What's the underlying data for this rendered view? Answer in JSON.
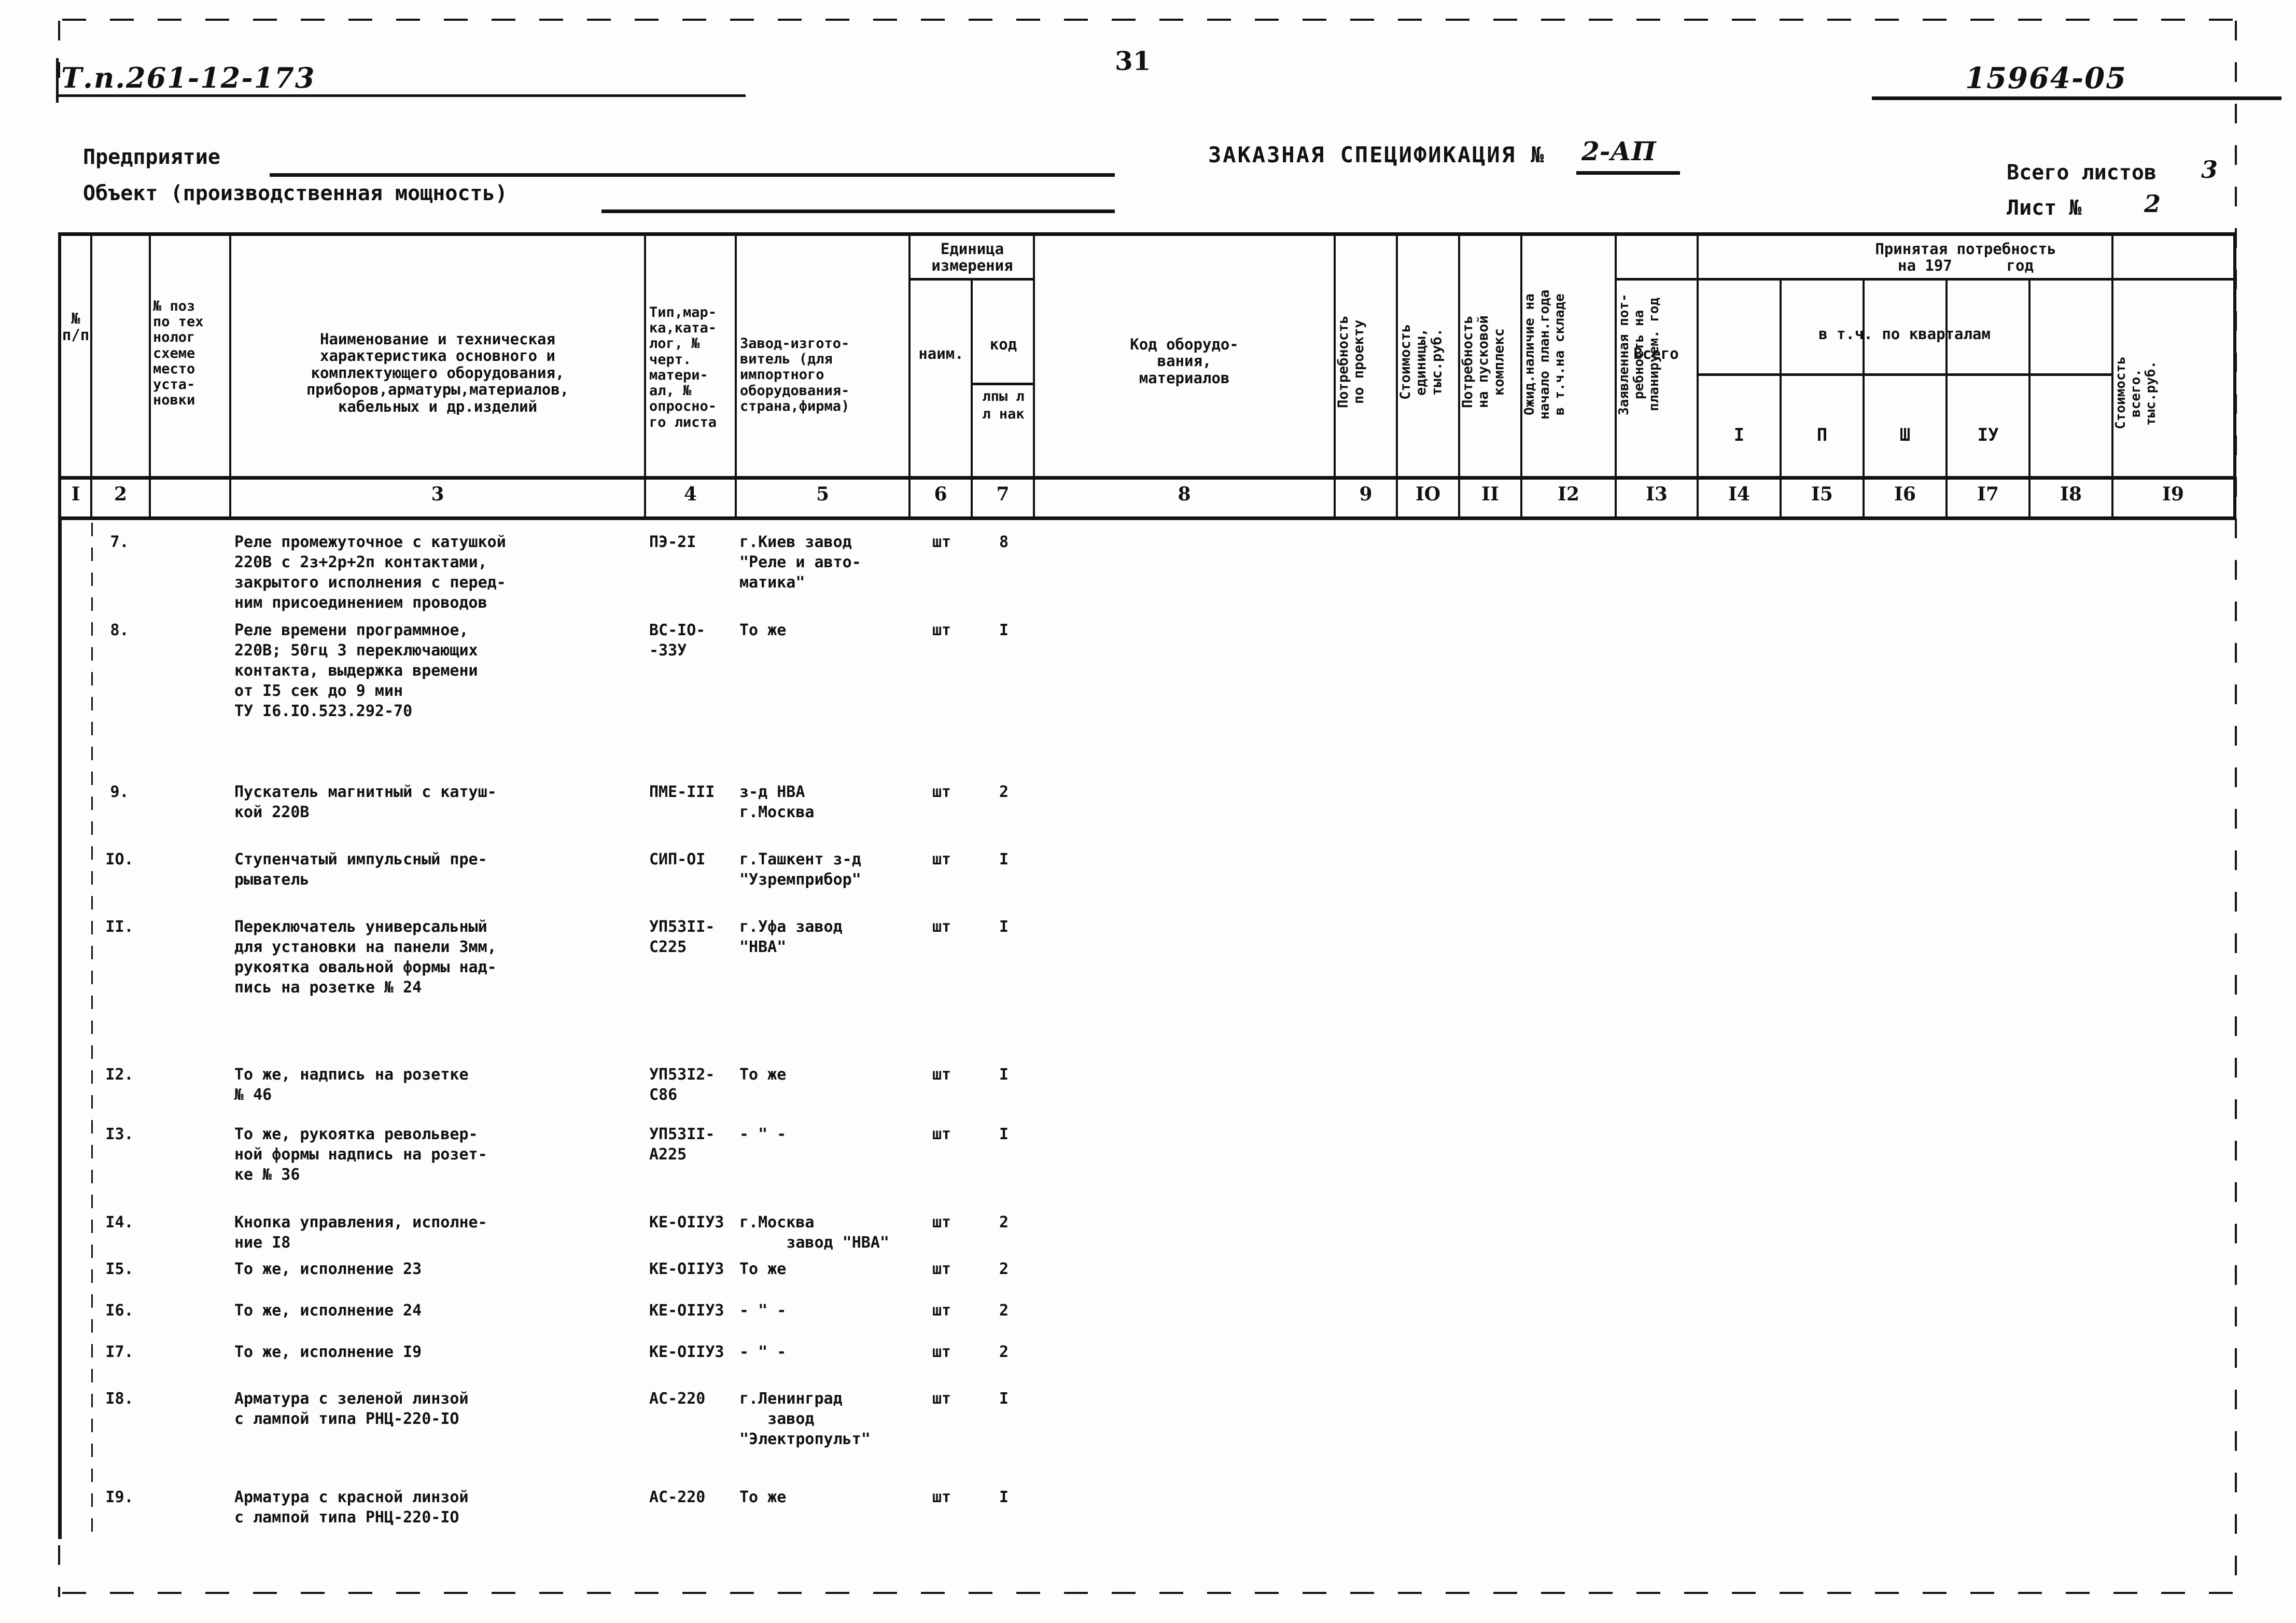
{
  "header": {
    "project_code": "Т.п.261-12-173",
    "page_number": "31",
    "document_number": "15964-05",
    "enterprise_label": "Предприятие",
    "object_label": "Объект (производственная мощность)",
    "spec_title": "ЗАКАЗНАЯ СПЕЦИФИКАЦИЯ №",
    "spec_number": "2-АП",
    "total_sheets_label": "Всего листов",
    "total_sheets_value": "3",
    "sheet_label": "Лист №",
    "sheet_value": "2"
  },
  "table": {
    "headers": {
      "c1": "№\nп/п",
      "c2": "№ поз\nпо тех\nнолог\nсхеме\nместо\nуста-\nновки",
      "c3": "Наименование и техническая\nхарактеристика основного и\nкомплектующего оборудования,\nприборов,арматуры,материалов,\nкабельных и др.изделий",
      "c4": "Тип,мар-\nка,ката-\nлог, №\nчерт.\nматери-\nал, №\nопросно-\nго листа",
      "c5": "Завод-изгото-\nвитель (для\nимпортного\nоборудования-\nстрана,фирма)",
      "unit_group": "Единица\nизмерения",
      "c6": "наим.",
      "c7_top": "код",
      "c7_bottom": "лпы л\nл нак",
      "c8": "Код оборудо-\nвания,\nматериалов",
      "c9": "Потребность\nпо проекту",
      "c10": "Стоимость\nединицы,\nтыс.руб.",
      "c11": "Потребность\nна пусковой\nкомплекс",
      "c12": "Ожид.наличие на\nначало план.года\nв т.ч.на складе",
      "c13": "Заявленная пот-\nребность на\nпланируем. год",
      "accepted_group": "Принятая потребность\nна 197      год",
      "c14": "Всего",
      "quarters_group": "в т.ч. по кварталам",
      "c15": "I",
      "c16": "П",
      "c17": "Ш",
      "c18": "IУ",
      "c19": "Стоимость\nвсего.\nтыс.руб."
    },
    "column_numbers": [
      "I",
      "2",
      "3",
      "4",
      "5",
      "6",
      "7",
      "8",
      "9",
      "IO",
      "II",
      "I2",
      "I3",
      "I4",
      "I5",
      "I6",
      "I7",
      "I8",
      "I9"
    ],
    "rows": [
      {
        "num": "7.",
        "name": "Реле промежуточное с катушкой\n220В с 2з+2р+2п контактами,\nзакрытого исполнения с перед-\nним присоединением проводов",
        "type": "ПЭ-2I",
        "maker": "г.Киев завод\n\"Реле и авто-\nматика\"",
        "unit": "шт",
        "qty": "8"
      },
      {
        "num": "8.",
        "name": "Реле времени программное,\n220В; 50гц 3 переключающих\nконтакта, выдержка времени\nот I5 сек до 9 мин\nТУ I6.IO.523.292-70",
        "type": "ВС-IO-\n-33У",
        "maker": "То же",
        "unit": "шт",
        "qty": "I"
      },
      {
        "num": "9.",
        "name": "Пускатель магнитный с катуш-\nкой 220В",
        "type": "ПМЕ-III",
        "maker": "з-д НВА\nг.Москва",
        "unit": "шт",
        "qty": "2"
      },
      {
        "num": "IO.",
        "name": "Ступенчатый импульсный пре-\nрыватель",
        "type": "СИП-OI",
        "maker": "г.Ташкент з-д\n\"Узремприбор\"",
        "unit": "шт",
        "qty": "I"
      },
      {
        "num": "II.",
        "name": "Переключатель универсальный\nдля установки на панели 3мм,\nрукоятка овальной формы над-\nпись на розетке № 24",
        "type": "УП53II-\nС225",
        "maker": "г.Уфа завод\n\"НВА\"",
        "unit": "шт",
        "qty": "I"
      },
      {
        "num": "I2.",
        "name": "То же, надпись на розетке\n№ 46",
        "type": "УП53I2-\nС86",
        "maker": "То же",
        "unit": "шт",
        "qty": "I"
      },
      {
        "num": "I3.",
        "name": "То же, рукоятка револьвер-\nной формы надпись на розет-\nке № 36",
        "type": "УП53II-\nА225",
        "maker": "- \" -",
        "unit": "шт",
        "qty": "I"
      },
      {
        "num": "I4.",
        "name": "Кнопка управления, исполне-\nние I8",
        "type": "КЕ-OIIУ3",
        "maker": "г.Москва\n     завод \"НВА\"",
        "unit": "шт",
        "qty": "2"
      },
      {
        "num": "I5.",
        "name": "То же, исполнение 23",
        "type": "КЕ-OIIУ3",
        "maker": "То же",
        "unit": "шт",
        "qty": "2"
      },
      {
        "num": "I6.",
        "name": "То же, исполнение 24",
        "type": "КЕ-OIIУ3",
        "maker": "- \" -",
        "unit": "шт",
        "qty": "2"
      },
      {
        "num": "I7.",
        "name": "То же, исполнение I9",
        "type": "КЕ-OIIУ3",
        "maker": "- \" -",
        "unit": "шт",
        "qty": "2"
      },
      {
        "num": "I8.",
        "name": "Арматура с зеленой линзой\nс лампой типа РНЦ-220-IO",
        "type": "АС-220",
        "maker": "г.Ленинград\n   завод\n\"Электропульт\"",
        "unit": "шт",
        "qty": "I"
      },
      {
        "num": "I9.",
        "name": "Арматура с красной линзой\nс лампой типа РНЦ-220-IO",
        "type": "АС-220",
        "maker": "То же",
        "unit": "шт",
        "qty": "I"
      }
    ]
  }
}
